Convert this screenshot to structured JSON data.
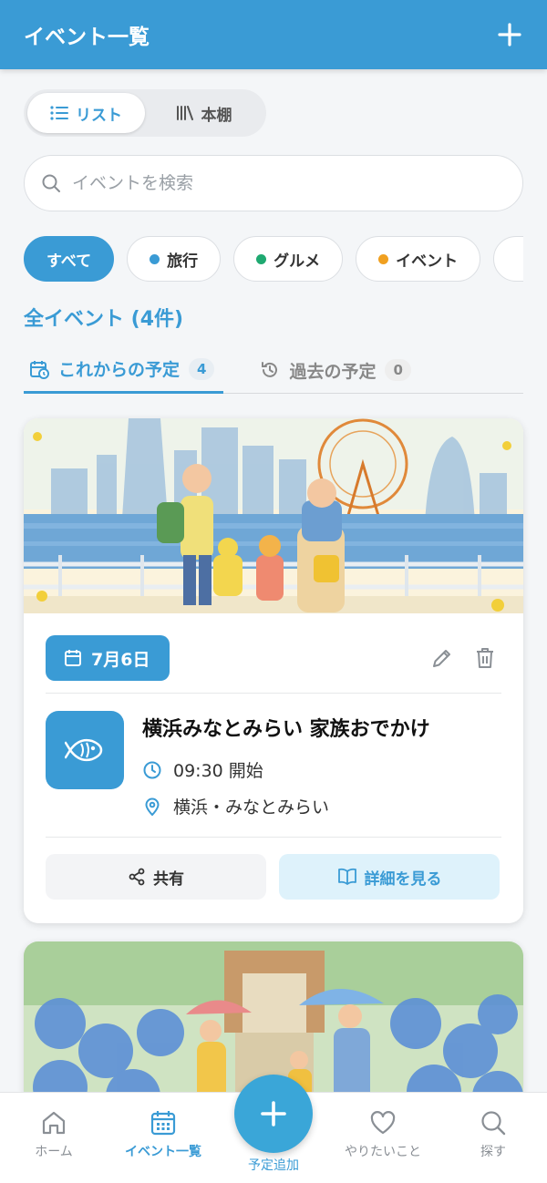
{
  "header": {
    "title": "イベント一覧",
    "add_icon": "plus-icon"
  },
  "view_toggle": {
    "list_label": "リスト",
    "shelf_label": "本棚"
  },
  "search": {
    "placeholder": "イベントを検索"
  },
  "filters": [
    {
      "label": "すべて",
      "color": ""
    },
    {
      "label": "旅行",
      "color": "#3a9bd5"
    },
    {
      "label": "グルメ",
      "color": "#1fa971"
    },
    {
      "label": "イベント",
      "color": "#f0a020"
    }
  ],
  "section_title": "全イベント (4件)",
  "tabs": [
    {
      "label": "これからの予定",
      "count": "4"
    },
    {
      "label": "過去の予定",
      "count": "0"
    }
  ],
  "event": {
    "date": "7月6日",
    "title": "横浜みなとみらい 家族おでかけ",
    "time": "09:30 開始",
    "location": "横浜・みなとみらい",
    "category_icon": "fish-icon",
    "share_label": "共有",
    "detail_label": "詳細を見る"
  },
  "bottom_nav": {
    "home": "ホーム",
    "events": "イベント一覧",
    "add": "予定追加",
    "wishlist": "やりたいこと",
    "explore": "探す"
  },
  "colors": {
    "primary": "#3a9bd5",
    "travel": "#3a9bd5",
    "gourmet": "#1fa971",
    "event": "#f0a020"
  }
}
